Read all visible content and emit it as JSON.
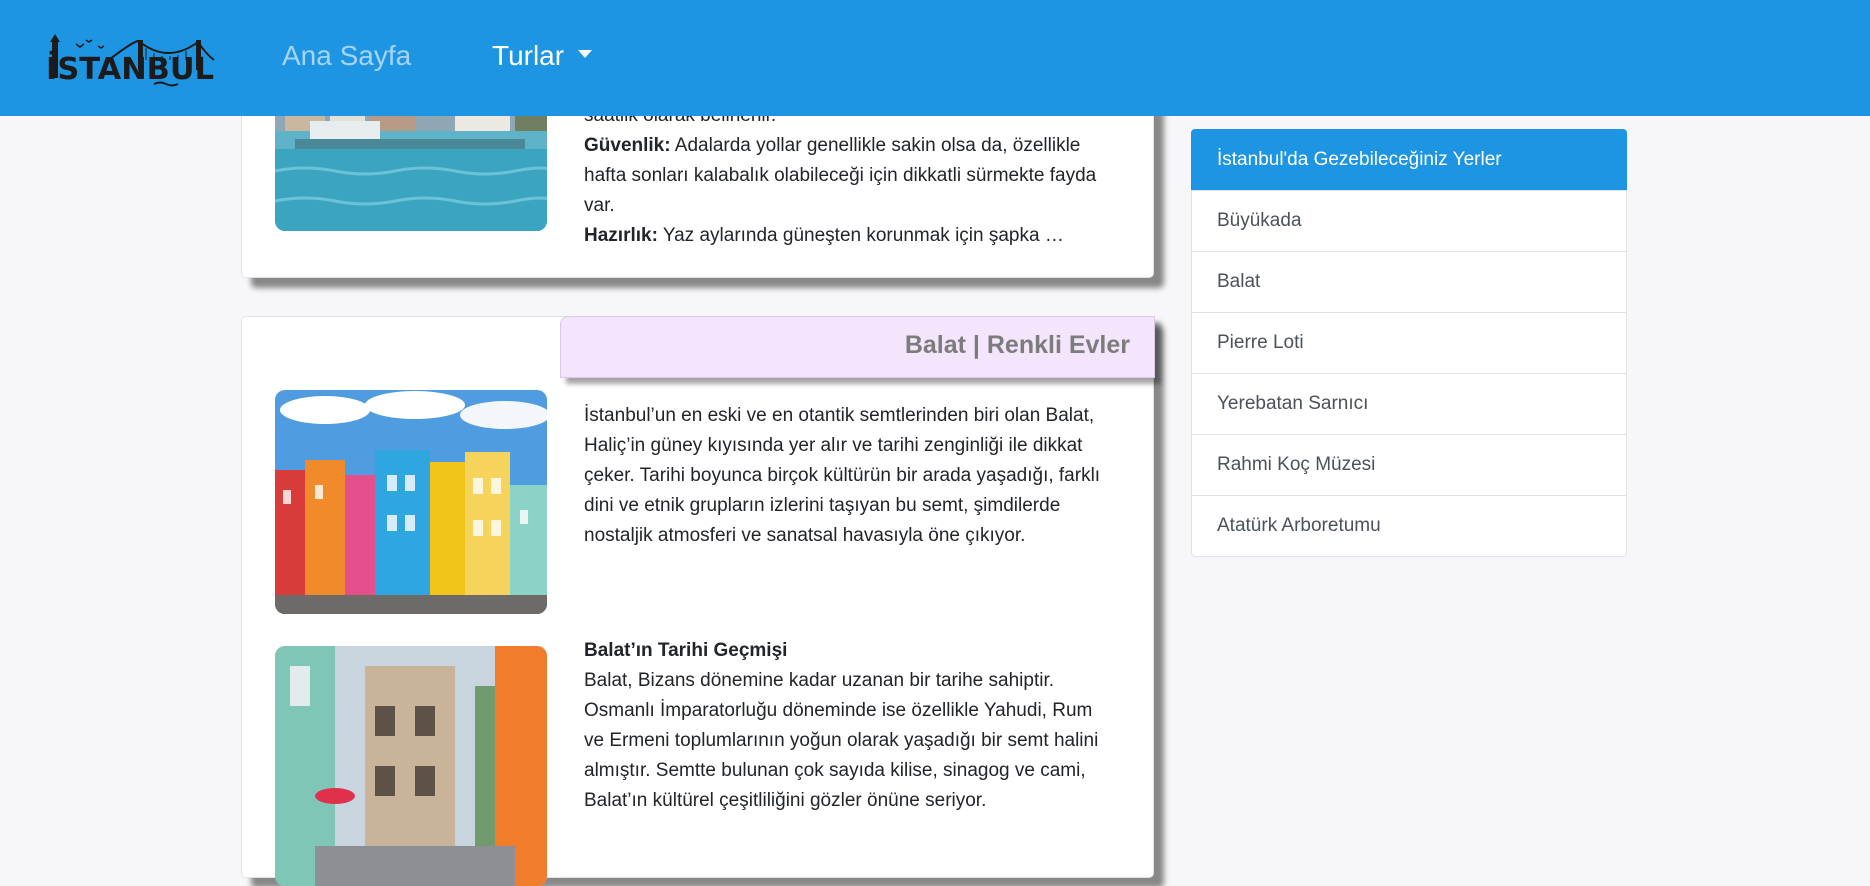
{
  "navbar": {
    "logo_text": "İSTANBUL",
    "home_label": "Ana Sayfa",
    "tours_label": "Turlar"
  },
  "card_top": {
    "clipped_line": "saatlik olarak belirlenir.",
    "p1_label": "Güvenlik:",
    "p1_text": " Adalarda yollar genellikle sakin olsa da, özellikle hafta sonları kalabalık olabileceği için dikkatli sürmekte fayda var.",
    "p2_label": "Hazırlık:",
    "p2_text": " Yaz aylarında güneşten korunmak için şapka …"
  },
  "card_balat": {
    "header": "Balat | Renkli Evler",
    "intro": "İstanbul’un en eski ve en otantik semtlerinden biri olan Balat, Haliç’in güney kıyısında yer alır ve tarihi zenginliği ile dikkat çeker. Tarihi boyunca birçok kültürün bir arada yaşadığı, farklı dini ve etnik grupların izlerini taşıyan bu semt, şimdilerde nostaljik atmosferi ve sanatsal havasıyla öne çıkıyor.",
    "history_title": "Balat’ın Tarihi Geçmişi",
    "history_text": "Balat, Bizans dönemine kadar uzanan bir tarihe sahiptir. Osmanlı İmparatorluğu döneminde ise özellikle Yahudi, Rum ve Ermeni toplumlarının yoğun olarak yaşadığı bir semt halini almıştır. Semtte bulunan çok sayıda kilise, sinagog ve cami, Balat’ın kültürel çeşitliliğini gözler önüne seriyor."
  },
  "sidebar": {
    "header": "İstanbul'da Gezebileceğiniz Yerler",
    "items": [
      {
        "label": "Büyükada"
      },
      {
        "label": "Balat"
      },
      {
        "label": "Pierre Loti"
      },
      {
        "label": "Yerebatan Sarnıcı"
      },
      {
        "label": "Rahmi Koç Müzesi"
      },
      {
        "label": "Atatürk Arboretumu"
      }
    ]
  },
  "colors": {
    "navbar": "#1e95e2",
    "card_header": "#f3e5fc",
    "active_item": "#1e95e2"
  }
}
